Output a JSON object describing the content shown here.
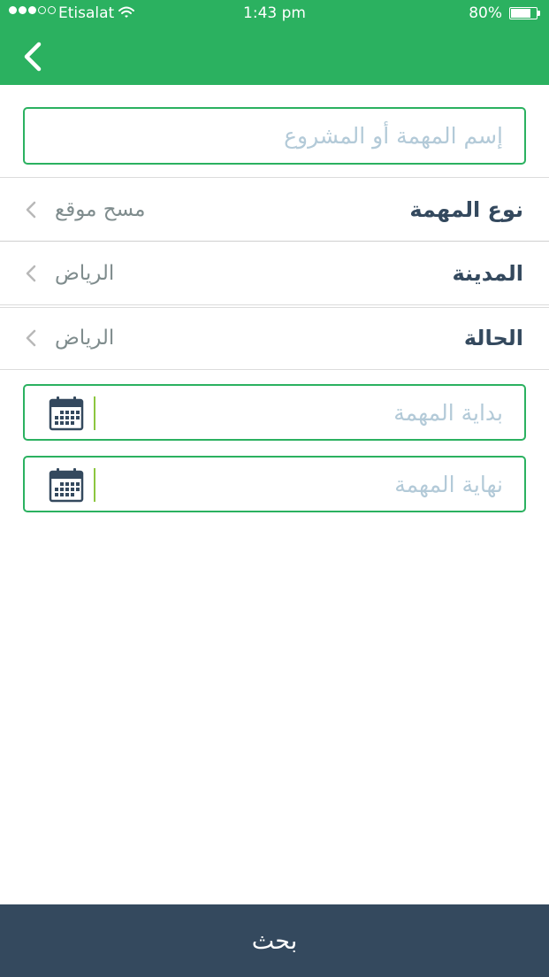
{
  "status_bar": {
    "carrier": "Etisalat",
    "time": "1:43 pm",
    "battery": "80%",
    "battery_level": 0.8,
    "signal_bars_filled": 3,
    "signal_bars_total": 5
  },
  "nav": {
    "back_icon": "chevron-left-icon"
  },
  "form": {
    "name_placeholder": "إسم المهمة أو المشروع",
    "rows": [
      {
        "label": "نوع المهمة",
        "value": "مسح موقع"
      },
      {
        "label": "المدينة",
        "value": "الرياض"
      },
      {
        "label": "الحالة",
        "value": "الرياض"
      }
    ],
    "start_placeholder": "بداية المهمة",
    "end_placeholder": "نهاية المهمة",
    "calendar_icon": "calendar-icon"
  },
  "footer": {
    "search_label": "بحث"
  },
  "colors": {
    "accent": "#2bb160",
    "dark": "#34495e",
    "placeholder": "#b3cad8",
    "secondary_text": "#7f8c8d"
  }
}
